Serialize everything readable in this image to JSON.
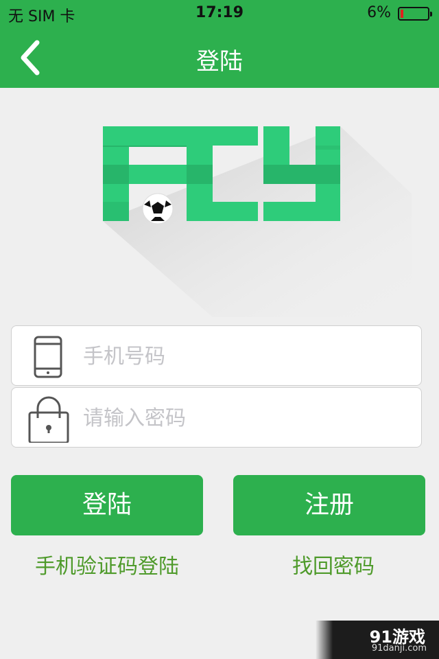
{
  "status_bar": {
    "carrier": "无 SIM 卡",
    "time": "17:19",
    "battery_percent": "6%"
  },
  "nav": {
    "title": "登陆",
    "back_icon": "chevron-left-icon"
  },
  "logo": {
    "text": "FCY",
    "brand_color": "#2ecc7a"
  },
  "form": {
    "phone_placeholder": "手机号码",
    "phone_value": "",
    "phone_icon": "phone-icon",
    "password_placeholder": "请输入密码",
    "password_value": "",
    "password_icon": "lock-icon"
  },
  "buttons": {
    "login_label": "登陆",
    "register_label": "注册"
  },
  "links": {
    "sms_login": "手机验证码登陆",
    "forgot_password": "找回密码"
  },
  "watermark": {
    "main": "91游戏",
    "sub": "91danji.com"
  },
  "colors": {
    "accent": "#2db04e",
    "link": "#4e9a2a",
    "background": "#efefef"
  }
}
